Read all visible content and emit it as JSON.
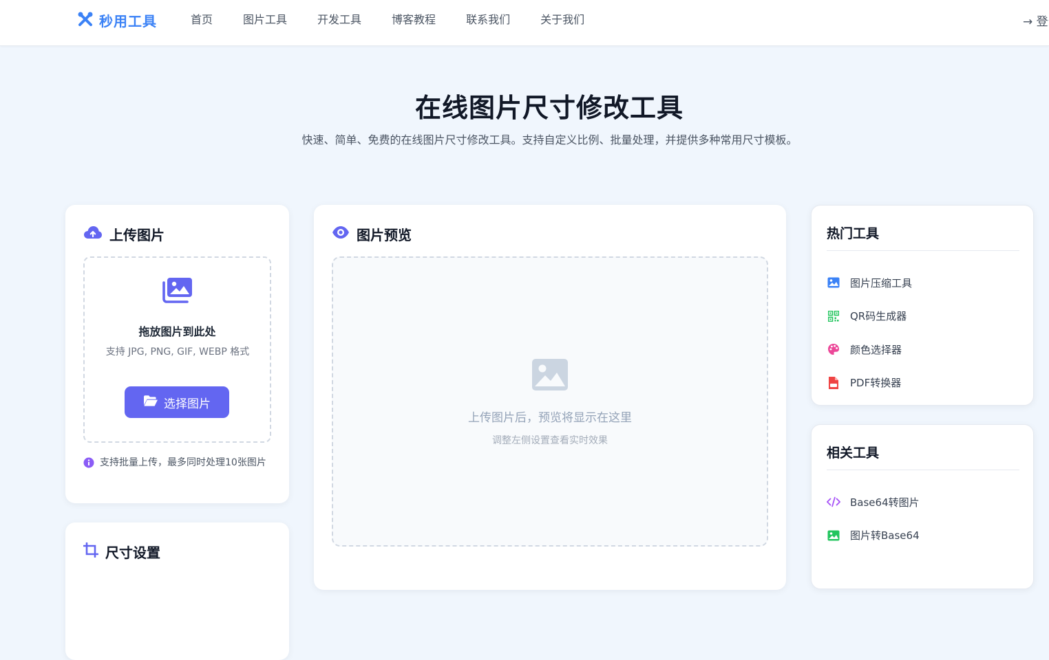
{
  "header": {
    "logo_text": "秒用工具",
    "nav": [
      "首页",
      "图片工具",
      "开发工具",
      "博客教程",
      "联系我们",
      "关于我们"
    ],
    "login_label": "→ 登录"
  },
  "hero": {
    "title": "在线图片尺寸修改工具",
    "subtitle": "快速、简单、免费的在线图片尺寸修改工具。支持自定义比例、批量处理，并提供多种常用尺寸模板。"
  },
  "upload": {
    "title": "上传图片",
    "drop_title": "拖放图片到此处",
    "formats": "支持 JPG, PNG, GIF, WEBP 格式",
    "choose_button": "选择图片",
    "batch_note": "支持批量上传，最多同时处理10张图片"
  },
  "size_settings": {
    "title": "尺寸设置"
  },
  "preview": {
    "title": "图片预览",
    "placeholder": "上传图片后，预览将显示在这里",
    "hint": "调整左侧设置查看实时效果"
  },
  "hot_tools": {
    "title": "热门工具",
    "items": [
      {
        "label": "图片压缩工具",
        "icon": "image-icon",
        "color": "#3b82f6"
      },
      {
        "label": "QR码生成器",
        "icon": "qrcode-icon",
        "color": "#22c55e"
      },
      {
        "label": "颜色选择器",
        "icon": "palette-icon",
        "color": "#ec4899"
      },
      {
        "label": "PDF转换器",
        "icon": "pdf-icon",
        "color": "#ef4444"
      }
    ]
  },
  "related_tools": {
    "title": "相关工具",
    "items": [
      {
        "label": "Base64转图片",
        "icon": "code-icon",
        "color": "#a855f7"
      },
      {
        "label": "图片转Base64",
        "icon": "image-icon",
        "color": "#22c55e"
      }
    ]
  },
  "colors": {
    "primary": "#6366f1",
    "logo": "#3b82f6",
    "page_bg": "#f0f6fd"
  }
}
